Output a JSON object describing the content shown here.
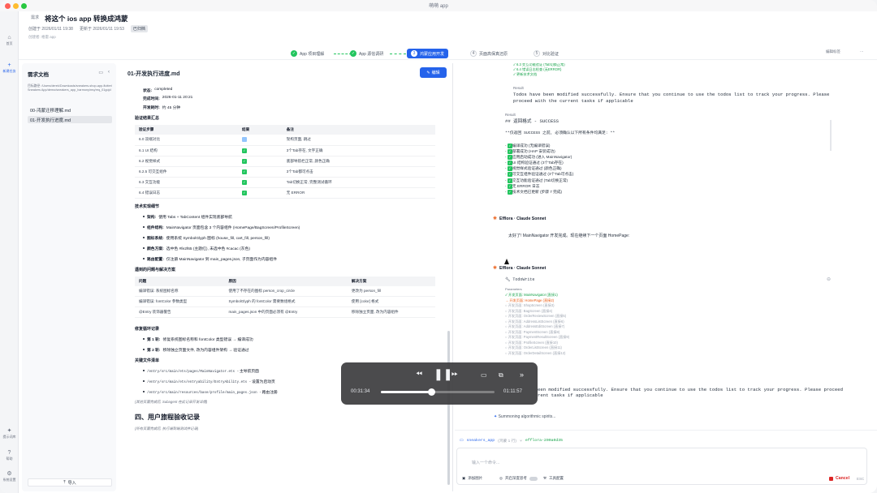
{
  "window": {
    "title": "萌萌 app"
  },
  "rail": {
    "items": [
      {
        "label": "首页",
        "icon": "home-icon"
      },
      {
        "label": "新建任务",
        "icon": "plus-icon"
      },
      {
        "label": "提示词库",
        "icon": "sparkle-icon"
      },
      {
        "label": "帮助",
        "icon": "help-icon"
      },
      {
        "label": "系统设置",
        "icon": "gear-icon"
      }
    ]
  },
  "header": {
    "back_label": "需求",
    "title": "将这个 ios app 转换成鸿蒙",
    "created": "创建于 2026/01/11 19:38",
    "updated": "更新于 2026/01/11 19:53",
    "status": "已归档",
    "creator": "创建者: 格雷 app"
  },
  "steps": [
    {
      "num": "✓",
      "label": "App 项目理解",
      "state": "done"
    },
    {
      "num": "✓",
      "label": "App 源信调研",
      "state": "done"
    },
    {
      "num": "3",
      "label": "鸿蒙应用开发",
      "state": "current"
    },
    {
      "num": "4",
      "label": "页面高保真还原",
      "state": "todo"
    },
    {
      "num": "5",
      "label": "对比验证",
      "state": "todo"
    }
  ],
  "steps_right": {
    "edit": "编辑标签",
    "more": "⋯"
  },
  "doclist": {
    "title": "需求文档",
    "path": "目标路径: /Users/derek/Downloads/sneakers-shop-app-flutter/Sneakers App/demo/sneakers_app_harmony/req/req_01gojd",
    "files": [
      "00-鸿蒙迁移理解.md",
      "01-开发执行进度.md"
    ],
    "import_label": "导入"
  },
  "viewer": {
    "doc_name": "01-开发执行进度.md",
    "edit_label": "编辑",
    "status_label": "状态:",
    "status_value": "completed",
    "done_label": "完成时间:",
    "done_value": "2026-01-11 20:21",
    "duration_label": "开发耗时:",
    "duration_value": "约 45 分钟",
    "verify_title": "验证结果汇总",
    "verify_headers": [
      "验证步骤",
      "结果",
      "备注"
    ],
    "verify_rows": [
      {
        "step": "6.0 双端对比",
        "result": "skip",
        "note": "架构页面, 跳过"
      },
      {
        "step": "6.1 UI 结构",
        "result": "ok",
        "note": "3个Tab存在, 文字正确"
      },
      {
        "step": "6.2 视觉样式",
        "result": "ok",
        "note": "底部导航栏正常, 颜色正确"
      },
      {
        "step": "6.2.5 可交互组件",
        "result": "ok",
        "note": "3个Tab都可点击"
      },
      {
        "step": "6.3 交互功能",
        "result": "ok",
        "note": "Tab切换正常, 完整测试循环"
      },
      {
        "step": "6.4 错误日志",
        "result": "ok",
        "note": "无 ERROR"
      }
    ],
    "tech_title": "技术实现细节",
    "tech_items": [
      {
        "k": "架构:",
        "v": "使用 Tabs + TabContent 组件实现底部导航"
      },
      {
        "k": "组件结构:",
        "v": "MainNavigator 页面包含 3 个内容组件 (HomePage/BagScreen/ProfileScreen)"
      },
      {
        "k": "图标系统:",
        "v": "使用系统 SymbolGlyph 图标 (house_fill, cart_fill, person_fill)"
      },
      {
        "k": "颜色方案:",
        "v": "选中色 #fe2f65 (主题红), 未选中色 #cacac (灰色)"
      },
      {
        "k": "路由配置:",
        "v": "仅注册 MainNavigator 到 main_pages.json, 子页面作为内容组件"
      }
    ],
    "problem_title": "遇到的问题与解决方案",
    "problem_headers": [
      "问题",
      "原因",
      "解决方案"
    ],
    "problem_rows": [
      {
        "p": "编译错误: 系统图标名称",
        "c": "使用了不存在的图标 person_crop_circle",
        "s": "更改为 person_fill"
      },
      {
        "p": "编译错误: fontColor 参数类型",
        "c": "SymbolGlyph 的 fontColor 需要数组格式",
        "s": "使用 [color] 格式"
      },
      {
        "p": "@Entry 装饰器警告",
        "c": "main_pages.json 中的页面必须有 @Entry",
        "s": "移除独立页面, 改为内容组件"
      }
    ],
    "fix_title": "修复循环记录",
    "fix_items": [
      {
        "k": "第 1 轮:",
        "v": "修复系统图标名称和 fontColor 类型错误 → 编译成功"
      },
      {
        "k": "第 2 轮:",
        "v": "移除独立页面文件, 改为内容组件架构 → 验证通过"
      }
    ],
    "files_title": "关键文件清单",
    "file_items": [
      {
        "path": "/entry/src/main/ets/pages/MainNavigator.ets",
        "desc": " - 主导航页面"
      },
      {
        "path": "/entry/src/main/ets/entryability/EntryAbility.ets",
        "desc": " - 设置为启动页"
      },
      {
        "path": "/entry/src/main/resources/base/profile/main_pages.json",
        "desc": " - 路由注册"
      }
    ],
    "files_note": "(其他页面完成后, Subagent 在此记录开发详情)",
    "section4": "四、用户旅程验收记录",
    "section4_note": "(所有页面完成后, 执行端到端测试并记录)"
  },
  "chat": {
    "top_list": [
      "6.3 交互功能验证 (Tab切换正常)",
      "6.4 错误日志检查 (无ERROR)",
      "更新技术文档"
    ],
    "result_label": "Result",
    "result_text": "Todos have been modified successfully. Ensure that you continue to use the todos list to track your progress. Please proceed with the current tasks if applicable",
    "result2_label": "Result",
    "return_title": "## 返回格式 - SUCCESS",
    "return_note": "**仅返回 SUCCESS 之前, 必须确认以下所有条件均满足: **",
    "checks": [
      "编译成功 (无编译错误)",
      "部署成功 (HAP 安装成功)",
      "应用启动成功 (进入 MainNavigator)",
      "UI 结构验证通过 (3个Tab存在)",
      "视觉样式验证通过 (颜色正确)",
      "可交互组件验证通过 (3个Tab可点击)",
      "交互功能验证通过 (Tab切换正常)",
      "无 ERROR 日志",
      "技术文档已更新 (步骤 7 完成)"
    ],
    "agent1": "Efflora · Claude Sonnet",
    "agent1_msg": "太好了! MainNavigator 开发完成。现在继续下一个页面 HomePage:",
    "agent2": "Efflora · Claude Sonnet",
    "tool_name": "TodoWrite",
    "params_label": "Parameters",
    "params": [
      {
        "s": "done",
        "t": "开发页面: MainNavigator (直接1)"
      },
      {
        "s": "progress",
        "t": "开发页面: HomePage (直接2)"
      },
      {
        "s": "todo",
        "t": "开发页面: ShopScreen (直接3)"
      },
      {
        "s": "todo",
        "t": "开发页面: BagScreen (直接4)"
      },
      {
        "s": "todo",
        "t": "开发页面: OrderReviewScreen (直接5)"
      },
      {
        "s": "todo",
        "t": "开发页面: AddressListScreen (直接6)"
      },
      {
        "s": "todo",
        "t": "开发页面: AddressEditScreen (直接7)"
      },
      {
        "s": "todo",
        "t": "开发页面: PaymentScreen (直接8)"
      },
      {
        "s": "todo",
        "t": "开发页面: PaymentResultScreen (直接9)"
      },
      {
        "s": "todo",
        "t": "开发页面: ProfileScreen (直接10)"
      },
      {
        "s": "todo",
        "t": "开发页面: OrderListScreen (直接11)"
      },
      {
        "s": "todo",
        "t": "开发页面: OrderDetailScreen (直接12)"
      }
    ],
    "partial1": "een modified successfully. Ensure that you continue to use the todos list to track your progress. Please proceed",
    "partial2": "rent tasks if applicable",
    "thinking": "Summoning algorithmic spirits...",
    "project": "sneakers_app",
    "project_tag": "(鸿蒙 1 行)",
    "branch": "efflora-200a0d35"
  },
  "composer": {
    "placeholder": "输入一个命令...",
    "attach": "添加图片",
    "mode": "开启深度思考",
    "tools": "工具配置",
    "cancel": "Cancel",
    "esc": "ESC"
  },
  "player": {
    "current": "00:31:34",
    "total": "01:11:57",
    "progress": 0.44
  }
}
